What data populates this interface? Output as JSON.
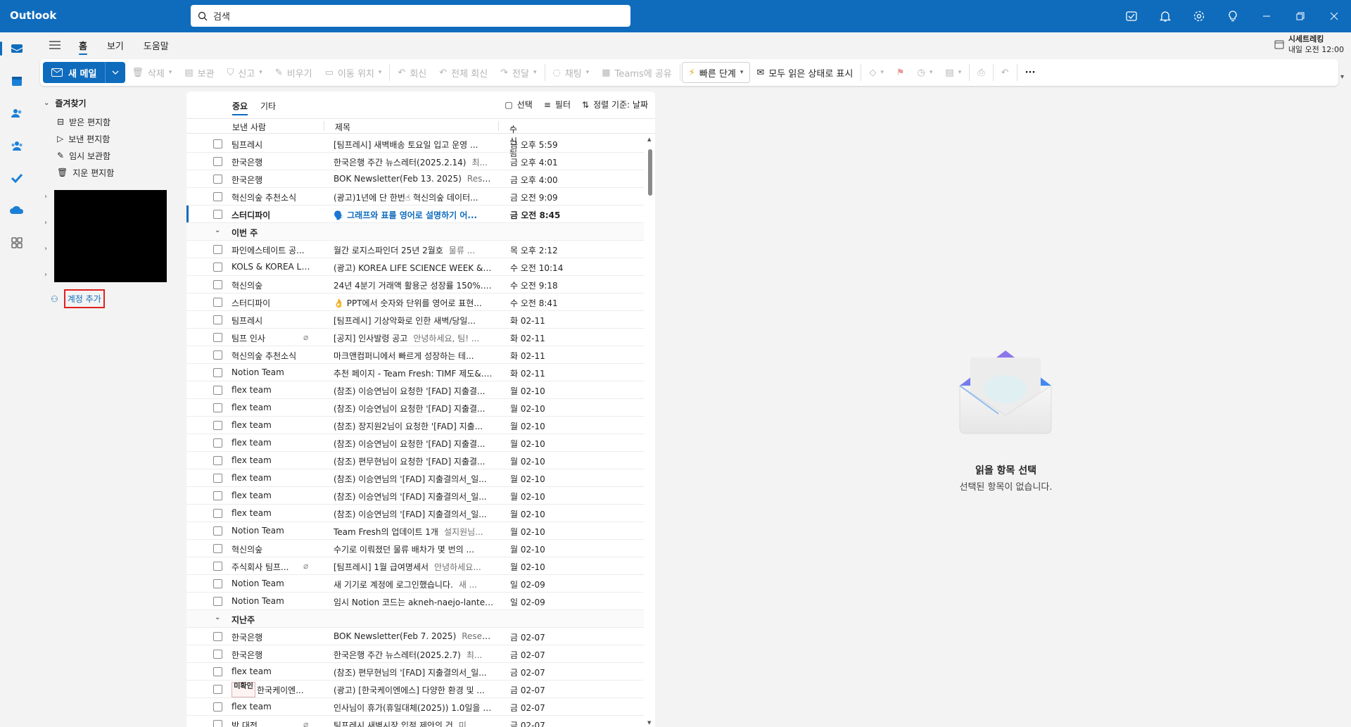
{
  "app": {
    "title": "Outlook"
  },
  "search": {
    "placeholder": "검색"
  },
  "tabs": [
    "홈",
    "보기",
    "도움말"
  ],
  "reminder": {
    "title": "시세트레킹",
    "time": "내일 오전 12:00"
  },
  "ribbon": {
    "new_mail": "새 메일",
    "delete": "삭제",
    "archive": "보관",
    "report": "신고",
    "sweep": "비우기",
    "move": "이동 위치",
    "reply": "회신",
    "reply_all": "전체 회신",
    "forward": "전달",
    "chat": "채팅",
    "teams": "Teams에 공유",
    "quick_steps": "빠른 단계",
    "mark_all_read": "모두 읽은 상태로 표시"
  },
  "folders": {
    "favorites": "즐겨찾기",
    "items": [
      "받은 편지함",
      "보낸 편지함",
      "임시 보관함",
      "지운 편지함"
    ],
    "add_account": "계정 추가"
  },
  "list": {
    "pivot_focused": "중요",
    "pivot_other": "기타",
    "select": "선택",
    "filter": "필터",
    "sort": "정렬 기준: 날짜",
    "col_from": "보낸 사람",
    "col_subject": "제목",
    "col_received": "수신됨",
    "groups": {
      "this_week": "이번 주",
      "last_week": "지난주"
    },
    "today": [
      {
        "from": "팀프레시",
        "subject": "[팀프레시] 새벽배송 토요일 입고 운영 ...",
        "preview": "",
        "date": "금 오후 5:59"
      },
      {
        "from": "한국은행",
        "subject": "한국은행 주간 뉴스레터(2025.2.14)",
        "preview": "최...",
        "date": "금 오후 4:01"
      },
      {
        "from": "한국은행",
        "subject": "BOK Newsletter(Feb 13. 2025)",
        "preview": "Researc...",
        "date": "금 오후 4:00"
      },
      {
        "from": "혁신의숲 추천소식",
        "subject": "(광고)1년에 단 한번☝ 혁신의숲 데이터...",
        "preview": "",
        "date": "금 오전 9:09"
      },
      {
        "from": "스터디파이",
        "subject": "🗣️ 그래프와 표를 영어로 설명하기 어...",
        "preview": "",
        "date": "금 오전 8:45"
      }
    ],
    "this_week": [
      {
        "from": "파인에스테이트 공...",
        "subject": "월간 로지스파인더 25년 2월호",
        "preview": "물류 ...",
        "date": "목 오후 2:12"
      },
      {
        "from": "KOLS & KOREA LA...",
        "subject": "(광고) KOREA LIFE SCIENCE WEEK & K...",
        "preview": "",
        "date": "수 오전 10:14"
      },
      {
        "from": "혁신의숲",
        "subject": "24년 4분기 거래액 활용군 성장률 150%...",
        "preview": "",
        "date": "수 오전 9:18"
      },
      {
        "from": "스터디파이",
        "subject": "👌 PPT에서 숫자와 단위를 영어로 표현...",
        "preview": "",
        "date": "수 오전 8:41"
      },
      {
        "from": "팀프레시",
        "subject": "[팀프레시] 기상악화로 인한 새벽/당일...",
        "preview": "",
        "date": "화 02-11"
      },
      {
        "from": "팀프 인사",
        "subject": "[공지] 인사발령 공고",
        "preview": "안녕하세요, 팀! ...",
        "date": "화 02-11"
      },
      {
        "from": "혁신의숲 추천소식",
        "subject": "마크앤컴퍼니에서 빠르게 성장하는 테...",
        "preview": "",
        "date": "화 02-11"
      },
      {
        "from": "Notion Team",
        "subject": "추천 페이지 - Team Fresh: TIMF 제도&...",
        "preview": "",
        "date": "화 02-11"
      },
      {
        "from": "flex team",
        "subject": "(참조) 이승연님이 요청한 '[FAD] 지출결...",
        "preview": "",
        "date": "월 02-10"
      },
      {
        "from": "flex team",
        "subject": "(참조) 이승연님이 요청한 '[FAD] 지출결...",
        "preview": "",
        "date": "월 02-10"
      },
      {
        "from": "flex team",
        "subject": "(참조) 장지원2님이 요청한 '[FAD] 지출...",
        "preview": "",
        "date": "월 02-10"
      },
      {
        "from": "flex team",
        "subject": "(참조) 이승연님이 요청한 '[FAD] 지출결...",
        "preview": "",
        "date": "월 02-10"
      },
      {
        "from": "flex team",
        "subject": "(참조) 편무현님이 요청한 '[FAD] 지출결...",
        "preview": "",
        "date": "월 02-10"
      },
      {
        "from": "flex team",
        "subject": "(참조) 이승연님의 '[FAD] 지출결의서_일...",
        "preview": "",
        "date": "월 02-10"
      },
      {
        "from": "flex team",
        "subject": "(참조) 이승연님의 '[FAD] 지출결의서_일...",
        "preview": "",
        "date": "월 02-10"
      },
      {
        "from": "flex team",
        "subject": "(참조) 이승연님의 '[FAD] 지출결의서_일...",
        "preview": "",
        "date": "월 02-10"
      },
      {
        "from": "Notion Team",
        "subject": "Team Fresh의 업데이트 1개",
        "preview": "설지원님...",
        "date": "월 02-10"
      },
      {
        "from": "혁신의숲",
        "subject": "수기로 이뤄졌던 물류 배차가 몇 번의 ...",
        "preview": "",
        "date": "월 02-10"
      },
      {
        "from": "주식회사 팀프...",
        "subject": "[팀프레시] 1월 급여명세서",
        "preview": "안녕하세요...",
        "date": "월 02-10"
      },
      {
        "from": "Notion Team",
        "subject": "새 기기로 계정에 로그인했습니다.",
        "preview": "새 ...",
        "date": "일 02-09"
      },
      {
        "from": "Notion Team",
        "subject": "임시 Notion 코드는 akneh-naejo-lante-...",
        "preview": "",
        "date": "일 02-09"
      }
    ],
    "last_week": [
      {
        "from": "한국은행",
        "subject": "BOK Newsletter(Feb 7. 2025)",
        "preview": "Researc...",
        "date": "금 02-07"
      },
      {
        "from": "한국은행",
        "subject": "한국은행 주간 뉴스레터(2025.2.7)",
        "preview": "최...",
        "date": "금 02-07"
      },
      {
        "from": "flex team",
        "subject": "(참조) 편무현님의 '[FAD] 지출결의서_일...",
        "preview": "",
        "date": "금 02-07"
      },
      {
        "from": "한국케이엔...",
        "subject": "(광고) [한국케이엔에스] 다양한 환경 및 ...",
        "preview": "",
        "date": "금 02-07"
      },
      {
        "from": "flex team",
        "subject": "인사님이 휴가(휴일대체(2025)) 1.0일을 ...",
        "preview": "",
        "date": "금 02-07"
      },
      {
        "from": "박 대전",
        "subject": "팀프레시 새벽시장 입점 제안의 건",
        "preview": "미...",
        "date": "금 02-07"
      }
    ],
    "avatar_text": "미확인"
  },
  "reading": {
    "title": "읽을 항목 선택",
    "subtitle": "선택된 항목이 없습니다."
  }
}
